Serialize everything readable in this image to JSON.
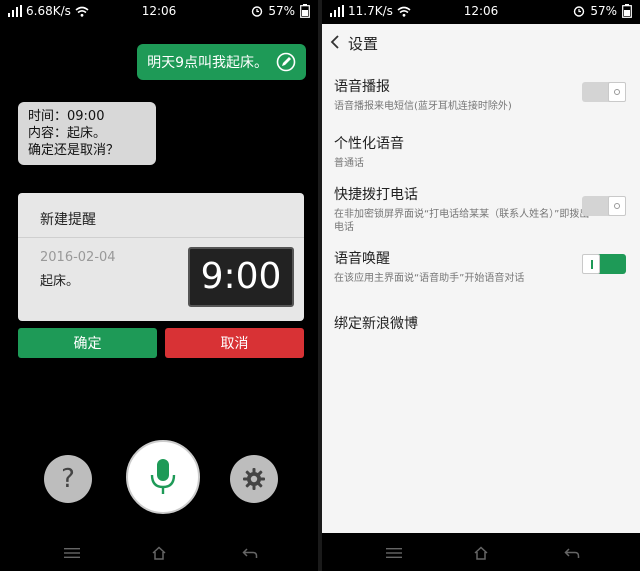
{
  "left": {
    "status": {
      "speed": "6.68K/s",
      "time": "12:06",
      "battery": "57%"
    },
    "user_message": "明天9点叫我起床。",
    "assistant_message": {
      "time_line": "时间：09:00",
      "content_line": "内容：起床。",
      "confirm_line": "确定还是取消？"
    },
    "reminder_card": {
      "title": "新建提醒",
      "date": "2016-02-04",
      "content": "起床。",
      "time": "9:00"
    },
    "buttons": {
      "confirm": "确定",
      "cancel": "取消"
    },
    "controls": {
      "help_glyph": "?"
    },
    "nav_icons": [
      "menu-icon",
      "home-icon",
      "back-icon"
    ]
  },
  "right": {
    "status": {
      "speed": "11.7K/s",
      "time": "12:06",
      "battery": "57%"
    },
    "header": {
      "title": "设置"
    },
    "settings": [
      {
        "title": "语音播报",
        "subtitle": "语音播报来电短信(蓝牙耳机连接时除外)",
        "toggle": "off"
      },
      {
        "title": "个性化语音",
        "subtitle": "普通话",
        "toggle": null
      },
      {
        "title": "快捷拨打电话",
        "subtitle": "在非加密锁屏界面说“打电话给某某（联系人姓名）”即拨出电话",
        "toggle": "off"
      },
      {
        "title": "语音唤醒",
        "subtitle": "在该应用主界面说“语音助手”开始语音对话",
        "toggle": "on"
      },
      {
        "title": "绑定新浪微博",
        "subtitle": "",
        "toggle": null
      }
    ],
    "nav_icons": [
      "menu-icon",
      "home-icon",
      "back-icon"
    ]
  },
  "colors": {
    "accent_green": "#1e9a57",
    "cancel_red": "#d83235",
    "bubble_gray": "#d8d8d8",
    "card_gray": "#e7e7e7"
  }
}
